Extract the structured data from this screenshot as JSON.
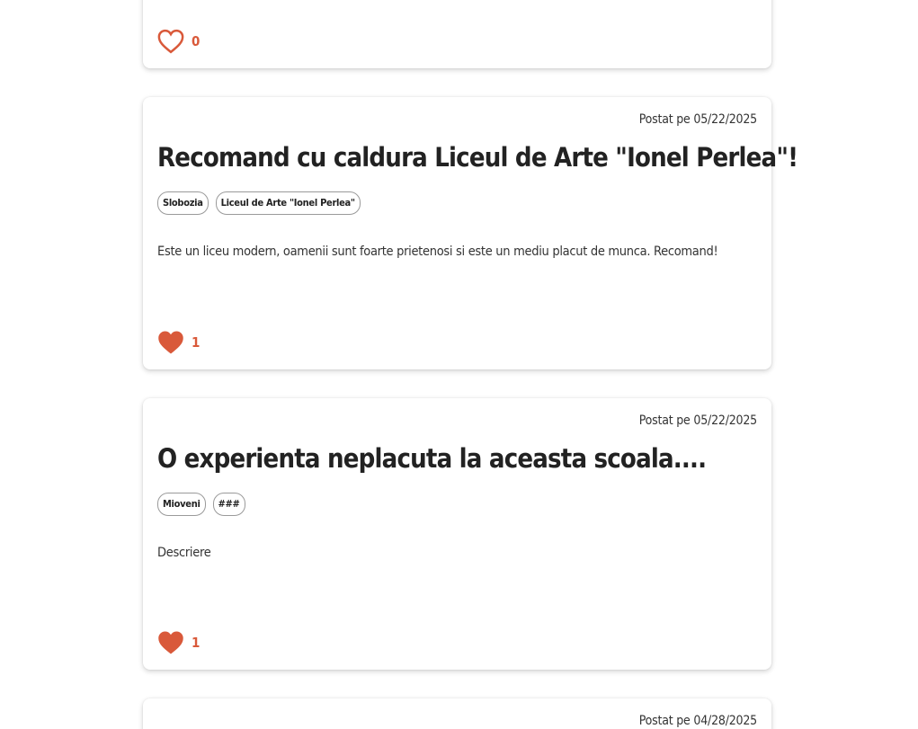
{
  "colors": {
    "accent": "#d9593a",
    "text": "#222222",
    "tag_border": "#9a9a9a",
    "background": "#ffffff"
  },
  "posts": [
    {
      "like_icon": "heart-outline-icon",
      "liked": false,
      "likes": "0"
    },
    {
      "date": "Postat pe 05/22/2025",
      "title": "Recomand cu caldura Liceul de Arte \"Ionel Perlea\"!",
      "tags": [
        "Slobozia",
        "Liceul de Arte \"Ionel Perlea\""
      ],
      "description": "Este un liceu modern, oamenii sunt foarte prietenosi si este un mediu placut de munca. Recomand!",
      "like_icon": "heart-filled-icon",
      "liked": true,
      "likes": "1"
    },
    {
      "date": "Postat pe 05/22/2025",
      "title": "O experienta neplacuta la aceasta scoala....",
      "tags": [
        "Mioveni",
        "###"
      ],
      "description": "Descriere",
      "like_icon": "heart-filled-icon",
      "liked": true,
      "likes": "1"
    },
    {
      "date": "Postat pe 04/28/2025"
    }
  ]
}
